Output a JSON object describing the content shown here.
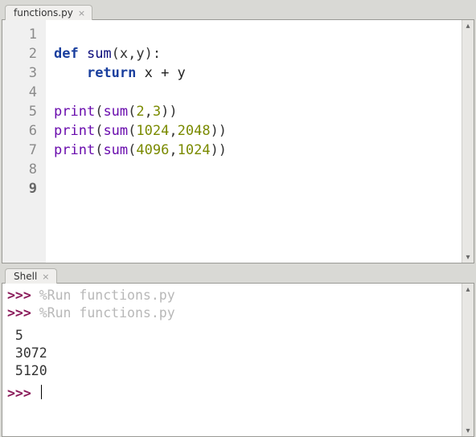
{
  "editor": {
    "tab_label": "functions.py",
    "lines": [
      {
        "n": "1",
        "tokens": []
      },
      {
        "n": "2",
        "tokens": [
          {
            "t": "kw",
            "s": "def "
          },
          {
            "t": "fn",
            "s": "sum"
          },
          {
            "t": "par",
            "s": "(x,y):"
          }
        ]
      },
      {
        "n": "3",
        "tokens": [
          {
            "t": "plain",
            "s": "    "
          },
          {
            "t": "kw",
            "s": "return"
          },
          {
            "t": "plain",
            "s": " x + y"
          }
        ]
      },
      {
        "n": "4",
        "tokens": []
      },
      {
        "n": "5",
        "tokens": [
          {
            "t": "call",
            "s": "print"
          },
          {
            "t": "par",
            "s": "("
          },
          {
            "t": "call",
            "s": "sum"
          },
          {
            "t": "par",
            "s": "("
          },
          {
            "t": "num",
            "s": "2"
          },
          {
            "t": "par",
            "s": ","
          },
          {
            "t": "num",
            "s": "3"
          },
          {
            "t": "par",
            "s": "))"
          }
        ]
      },
      {
        "n": "6",
        "tokens": [
          {
            "t": "call",
            "s": "print"
          },
          {
            "t": "par",
            "s": "("
          },
          {
            "t": "call",
            "s": "sum"
          },
          {
            "t": "par",
            "s": "("
          },
          {
            "t": "num",
            "s": "1024"
          },
          {
            "t": "par",
            "s": ","
          },
          {
            "t": "num",
            "s": "2048"
          },
          {
            "t": "par",
            "s": "))"
          }
        ]
      },
      {
        "n": "7",
        "tokens": [
          {
            "t": "call",
            "s": "print"
          },
          {
            "t": "par",
            "s": "("
          },
          {
            "t": "call",
            "s": "sum"
          },
          {
            "t": "par",
            "s": "("
          },
          {
            "t": "num",
            "s": "4096"
          },
          {
            "t": "par",
            "s": ","
          },
          {
            "t": "num",
            "s": "1024"
          },
          {
            "t": "par",
            "s": "))"
          }
        ]
      },
      {
        "n": "8",
        "tokens": []
      },
      {
        "n": "9",
        "tokens": [],
        "current": true
      }
    ]
  },
  "shell": {
    "tab_label": "Shell",
    "prompt": ">>> ",
    "lines": [
      {
        "type": "run",
        "text": "%Run functions.py"
      },
      {
        "type": "run",
        "text": "%Run functions.py"
      },
      {
        "type": "out",
        "text": " 5"
      },
      {
        "type": "out",
        "text": " 3072"
      },
      {
        "type": "out",
        "text": " 5120"
      },
      {
        "type": "prompt_live"
      }
    ]
  }
}
